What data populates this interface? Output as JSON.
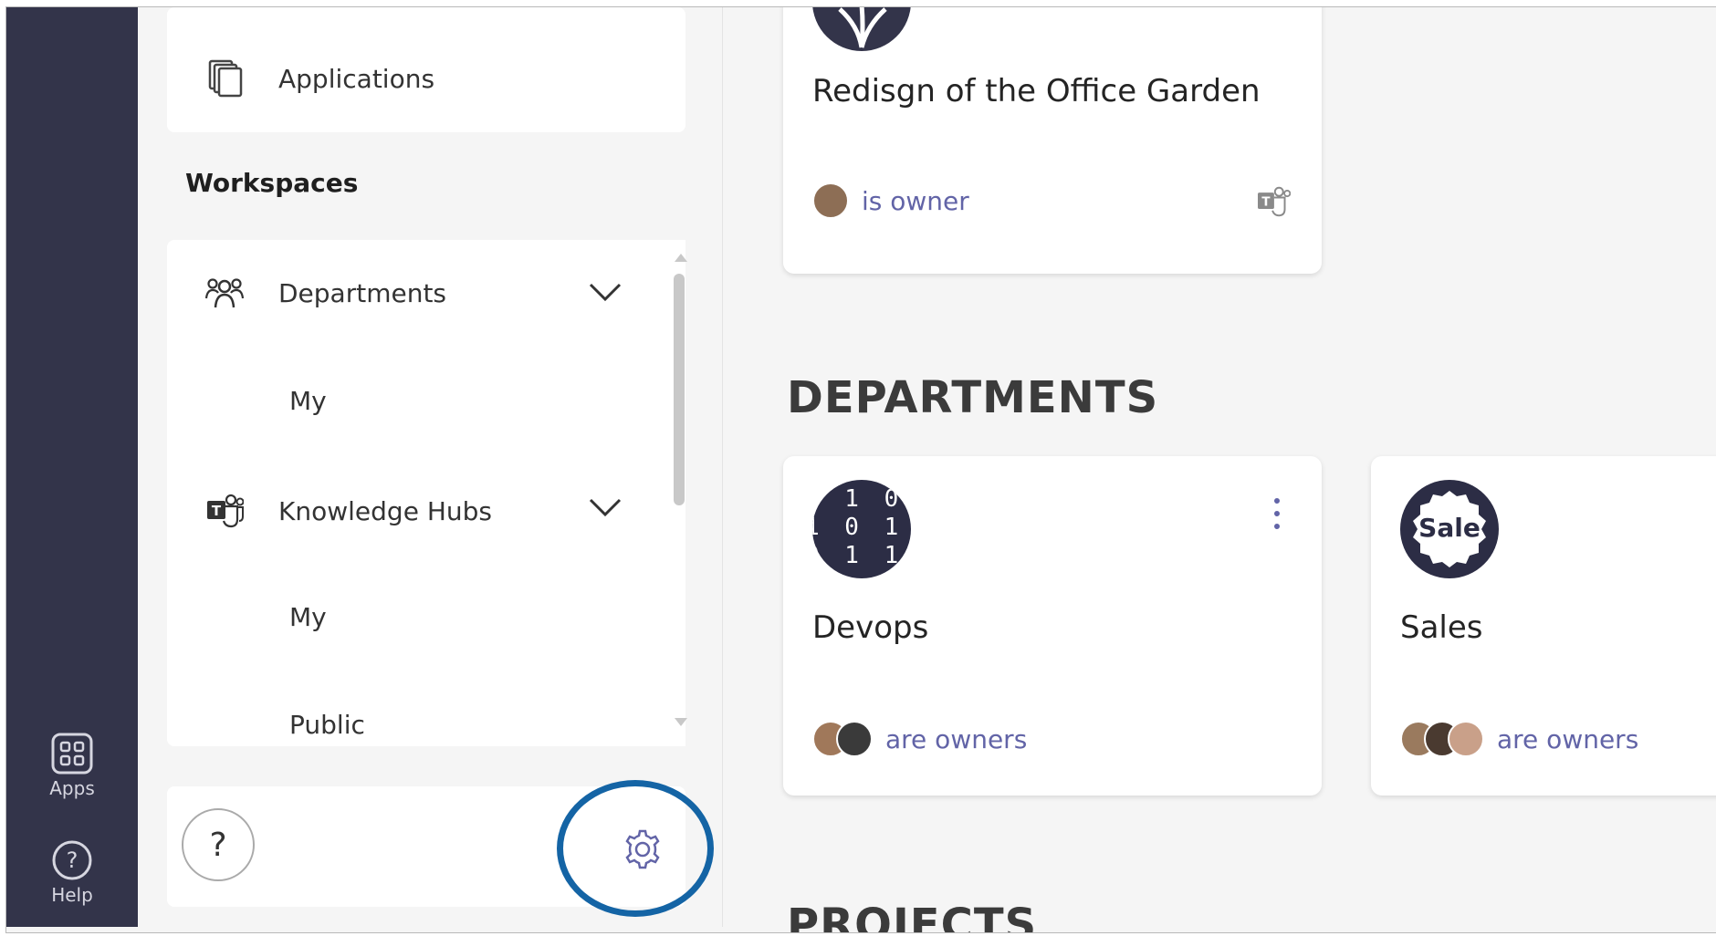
{
  "rail": {
    "apps_label": "Apps",
    "help_label": "Help"
  },
  "panel": {
    "applications_label": "Applications",
    "workspaces_title": "Workspaces",
    "groups": [
      {
        "label": "Departments",
        "icon": "people-icon",
        "children": [
          "My"
        ]
      },
      {
        "label": "Knowledge Hubs",
        "icon": "teams-icon",
        "children": [
          "My",
          "Public"
        ]
      }
    ],
    "help_symbol": "?",
    "settings_icon": "gear-icon"
  },
  "main": {
    "top_card": {
      "title": "Redisgn of the Office Garden",
      "owner_text": "is owner"
    },
    "departments_heading": "DEPARTMENTS",
    "departments": [
      {
        "title": "Devops",
        "owner_text": "are owners",
        "logo": "binary-logo"
      },
      {
        "title": "Sales",
        "owner_text": "are owners",
        "logo_text": "Sale"
      }
    ],
    "projects_heading": "PROJECTS"
  },
  "colors": {
    "rail_bg": "#33344a",
    "accent": "#6264a7",
    "highlight_ring": "#1464a5"
  }
}
